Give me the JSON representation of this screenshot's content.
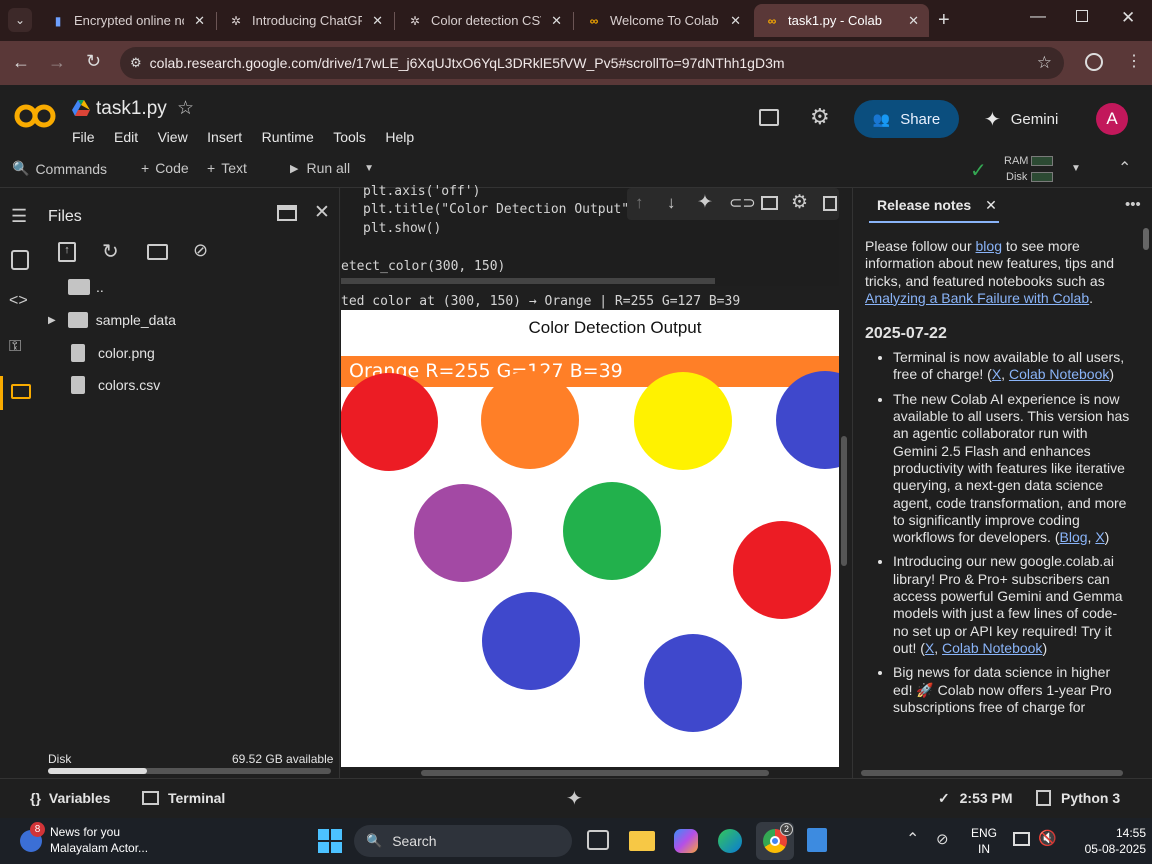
{
  "browser": {
    "tabs": [
      {
        "title": "Encrypted online no",
        "icon": "book-icon"
      },
      {
        "title": "Introducing ChatGPT",
        "icon": "openai-icon"
      },
      {
        "title": "Color detection CSV",
        "icon": "openai-icon"
      },
      {
        "title": "Welcome To Colab -",
        "icon": "colab-icon"
      },
      {
        "title": "task1.py - Colab",
        "icon": "colab-icon"
      }
    ],
    "url": "colab.research.google.com/drive/17wLE_j6XqUJtxO6YqL3DRklE5fVW_Pv5#scrollTo=97dNThh1gD3m"
  },
  "colab": {
    "title": "task1.py",
    "menu": [
      "File",
      "Edit",
      "View",
      "Insert",
      "Runtime",
      "Tools",
      "Help"
    ],
    "share_label": "Share",
    "gemini_label": "Gemini",
    "avatar_letter": "A",
    "toolbar": {
      "commands": "Commands",
      "code": "Code",
      "text": "Text",
      "run_all": "Run all",
      "ram": "RAM",
      "disk": "Disk"
    }
  },
  "files": {
    "title": "Files",
    "items": [
      "..",
      "sample_data",
      "color.png",
      "colors.csv"
    ],
    "disk_label": "Disk",
    "disk_available": "69.52 GB available",
    "disk_used_fraction": 0.35
  },
  "notebook": {
    "code_lines": [
      "plt.axis('off')",
      "plt.title(\"Color Detection Output\")",
      "plt.show()"
    ],
    "call_line": "etect_color(300, 150)",
    "output_text": "ted color at (300, 150) → Orange | R=255 G=127 B=39",
    "figure_title": "Color Detection Output",
    "banner_text": "Orange R=255 G=127 B=39",
    "banner_color": "#ff7f27",
    "circles": [
      {
        "color": "#ec1c24",
        "name": "red"
      },
      {
        "color": "#ff7f27",
        "name": "orange"
      },
      {
        "color": "#fff200",
        "name": "yellow"
      },
      {
        "color": "#3f48cc",
        "name": "blue"
      },
      {
        "color": "#a349a4",
        "name": "purple"
      },
      {
        "color": "#22b14c",
        "name": "green"
      },
      {
        "color": "#ec1c24",
        "name": "red"
      },
      {
        "color": "#3f48cc",
        "name": "blue"
      },
      {
        "color": "#3f48cc",
        "name": "blue"
      }
    ]
  },
  "notes": {
    "tab_label": "Release notes",
    "intro_pre": "Please follow our ",
    "intro_link": "blog",
    "intro_post": " to see more information about new features, tips and tricks, and featured notebooks such as ",
    "intro_link2": "Analyzing a Bank Failure with Colab",
    "date": "2025-07-22",
    "b1_pre": "Terminal is now available to all users, free of charge! (",
    "b1_l1": "X",
    "b1_l2": "Colab Notebook",
    "b2_pre": "The new Colab AI experience is now available to all users. This version has an agentic collaborator run with Gemini 2.5 Flash and enhances productivity with features like iterative querying, a next-gen data science agent, code transformation, and more to significantly improve coding workflows for developers. (",
    "b2_l1": "Blog",
    "b2_l2": "X",
    "b3_pre": "Introducing our new google.colab.ai library! Pro & Pro+ subscribers can access powerful Gemini and Gemma models with just a few lines of code- no set up or API key required! Try it out! (",
    "b3_l1": "X",
    "b3_l2": "Colab Notebook",
    "b4_text": "Big news for data science in higher ed! 🚀 Colab now offers 1-year Pro subscriptions free of charge for"
  },
  "status": {
    "variables": "Variables",
    "terminal": "Terminal",
    "time": "2:53 PM",
    "runtime": "Python 3"
  },
  "taskbar": {
    "news_title": "News for you",
    "news_sub": "Malayalam Actor...",
    "news_badge": "8",
    "search": "Search",
    "lang1": "ENG",
    "lang2": "IN",
    "clock_time": "14:55",
    "clock_date": "05-08-2025",
    "chrome_badge": "2"
  }
}
